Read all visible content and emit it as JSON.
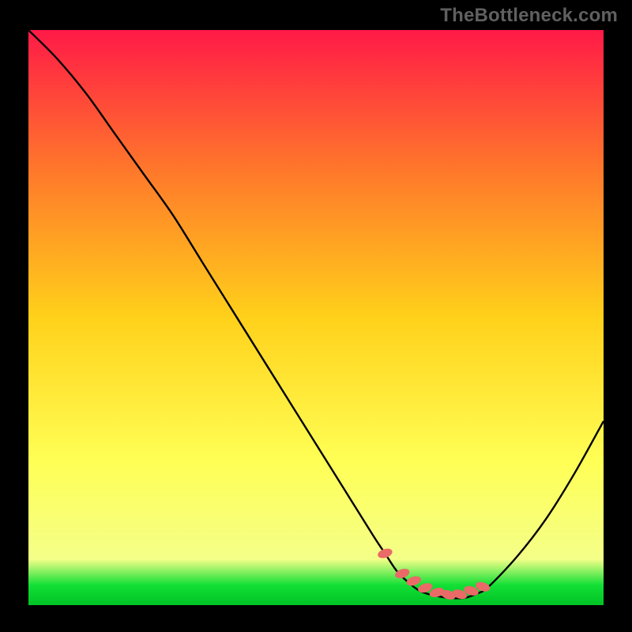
{
  "watermark": "TheBottleneck.com",
  "colors": {
    "background": "#000000",
    "watermark_text": "#606060",
    "curve": "#000000",
    "marker_fill": "#ea6a67",
    "marker_stroke": "#ea6a67",
    "gradient_top": "#ff1a47",
    "gradient_upper_mid": "#ff7a2a",
    "gradient_mid": "#ffd11a",
    "gradient_lower_mid": "#ffff55",
    "gradient_near_bottom": "#f4ff88",
    "gradient_band": "#12e035",
    "gradient_bottom": "#00c225"
  },
  "chart_data": {
    "type": "line",
    "title": "",
    "xlabel": "",
    "ylabel": "",
    "xlim": [
      0,
      100
    ],
    "ylim": [
      0,
      100
    ],
    "x": [
      0,
      5,
      10,
      15,
      20,
      25,
      30,
      35,
      40,
      45,
      50,
      55,
      60,
      62,
      64,
      66,
      68,
      70,
      72,
      74,
      76,
      78,
      80,
      85,
      90,
      95,
      100
    ],
    "values": [
      100,
      95,
      89,
      82,
      75,
      68,
      60,
      52,
      44,
      36,
      28,
      20,
      12,
      9,
      6,
      4,
      2.5,
      1.8,
      1.4,
      1.2,
      1.3,
      2.0,
      3.2,
      8.5,
      15,
      23,
      32
    ],
    "markers": {
      "x": [
        62,
        65,
        67,
        69,
        71,
        73,
        75,
        77,
        79
      ],
      "y": [
        9,
        5.5,
        4.2,
        3.0,
        2.2,
        1.8,
        1.9,
        2.5,
        3.2
      ]
    }
  }
}
